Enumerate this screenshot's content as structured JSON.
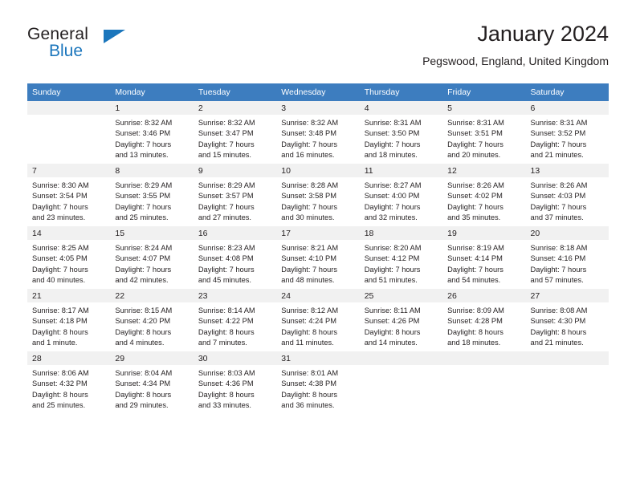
{
  "brand": {
    "line1": "General",
    "line2": "Blue",
    "triangle_color": "#1b76bc"
  },
  "header": {
    "title": "January 2024",
    "subtitle": "Pegswood, England, United Kingdom"
  },
  "theme": {
    "header_row_bg": "#3d7dbf",
    "header_row_text": "#ffffff",
    "daynum_bg": "#f1f1f1",
    "body_text": "#231f20"
  },
  "weekday_headers": [
    "Sunday",
    "Monday",
    "Tuesday",
    "Wednesday",
    "Thursday",
    "Friday",
    "Saturday"
  ],
  "weeks": [
    [
      {
        "day": "",
        "lines": []
      },
      {
        "day": "1",
        "lines": [
          "Sunrise: 8:32 AM",
          "Sunset: 3:46 PM",
          "Daylight: 7 hours",
          "and 13 minutes."
        ]
      },
      {
        "day": "2",
        "lines": [
          "Sunrise: 8:32 AM",
          "Sunset: 3:47 PM",
          "Daylight: 7 hours",
          "and 15 minutes."
        ]
      },
      {
        "day": "3",
        "lines": [
          "Sunrise: 8:32 AM",
          "Sunset: 3:48 PM",
          "Daylight: 7 hours",
          "and 16 minutes."
        ]
      },
      {
        "day": "4",
        "lines": [
          "Sunrise: 8:31 AM",
          "Sunset: 3:50 PM",
          "Daylight: 7 hours",
          "and 18 minutes."
        ]
      },
      {
        "day": "5",
        "lines": [
          "Sunrise: 8:31 AM",
          "Sunset: 3:51 PM",
          "Daylight: 7 hours",
          "and 20 minutes."
        ]
      },
      {
        "day": "6",
        "lines": [
          "Sunrise: 8:31 AM",
          "Sunset: 3:52 PM",
          "Daylight: 7 hours",
          "and 21 minutes."
        ]
      }
    ],
    [
      {
        "day": "7",
        "lines": [
          "Sunrise: 8:30 AM",
          "Sunset: 3:54 PM",
          "Daylight: 7 hours",
          "and 23 minutes."
        ]
      },
      {
        "day": "8",
        "lines": [
          "Sunrise: 8:29 AM",
          "Sunset: 3:55 PM",
          "Daylight: 7 hours",
          "and 25 minutes."
        ]
      },
      {
        "day": "9",
        "lines": [
          "Sunrise: 8:29 AM",
          "Sunset: 3:57 PM",
          "Daylight: 7 hours",
          "and 27 minutes."
        ]
      },
      {
        "day": "10",
        "lines": [
          "Sunrise: 8:28 AM",
          "Sunset: 3:58 PM",
          "Daylight: 7 hours",
          "and 30 minutes."
        ]
      },
      {
        "day": "11",
        "lines": [
          "Sunrise: 8:27 AM",
          "Sunset: 4:00 PM",
          "Daylight: 7 hours",
          "and 32 minutes."
        ]
      },
      {
        "day": "12",
        "lines": [
          "Sunrise: 8:26 AM",
          "Sunset: 4:02 PM",
          "Daylight: 7 hours",
          "and 35 minutes."
        ]
      },
      {
        "day": "13",
        "lines": [
          "Sunrise: 8:26 AM",
          "Sunset: 4:03 PM",
          "Daylight: 7 hours",
          "and 37 minutes."
        ]
      }
    ],
    [
      {
        "day": "14",
        "lines": [
          "Sunrise: 8:25 AM",
          "Sunset: 4:05 PM",
          "Daylight: 7 hours",
          "and 40 minutes."
        ]
      },
      {
        "day": "15",
        "lines": [
          "Sunrise: 8:24 AM",
          "Sunset: 4:07 PM",
          "Daylight: 7 hours",
          "and 42 minutes."
        ]
      },
      {
        "day": "16",
        "lines": [
          "Sunrise: 8:23 AM",
          "Sunset: 4:08 PM",
          "Daylight: 7 hours",
          "and 45 minutes."
        ]
      },
      {
        "day": "17",
        "lines": [
          "Sunrise: 8:21 AM",
          "Sunset: 4:10 PM",
          "Daylight: 7 hours",
          "and 48 minutes."
        ]
      },
      {
        "day": "18",
        "lines": [
          "Sunrise: 8:20 AM",
          "Sunset: 4:12 PM",
          "Daylight: 7 hours",
          "and 51 minutes."
        ]
      },
      {
        "day": "19",
        "lines": [
          "Sunrise: 8:19 AM",
          "Sunset: 4:14 PM",
          "Daylight: 7 hours",
          "and 54 minutes."
        ]
      },
      {
        "day": "20",
        "lines": [
          "Sunrise: 8:18 AM",
          "Sunset: 4:16 PM",
          "Daylight: 7 hours",
          "and 57 minutes."
        ]
      }
    ],
    [
      {
        "day": "21",
        "lines": [
          "Sunrise: 8:17 AM",
          "Sunset: 4:18 PM",
          "Daylight: 8 hours",
          "and 1 minute."
        ]
      },
      {
        "day": "22",
        "lines": [
          "Sunrise: 8:15 AM",
          "Sunset: 4:20 PM",
          "Daylight: 8 hours",
          "and 4 minutes."
        ]
      },
      {
        "day": "23",
        "lines": [
          "Sunrise: 8:14 AM",
          "Sunset: 4:22 PM",
          "Daylight: 8 hours",
          "and 7 minutes."
        ]
      },
      {
        "day": "24",
        "lines": [
          "Sunrise: 8:12 AM",
          "Sunset: 4:24 PM",
          "Daylight: 8 hours",
          "and 11 minutes."
        ]
      },
      {
        "day": "25",
        "lines": [
          "Sunrise: 8:11 AM",
          "Sunset: 4:26 PM",
          "Daylight: 8 hours",
          "and 14 minutes."
        ]
      },
      {
        "day": "26",
        "lines": [
          "Sunrise: 8:09 AM",
          "Sunset: 4:28 PM",
          "Daylight: 8 hours",
          "and 18 minutes."
        ]
      },
      {
        "day": "27",
        "lines": [
          "Sunrise: 8:08 AM",
          "Sunset: 4:30 PM",
          "Daylight: 8 hours",
          "and 21 minutes."
        ]
      }
    ],
    [
      {
        "day": "28",
        "lines": [
          "Sunrise: 8:06 AM",
          "Sunset: 4:32 PM",
          "Daylight: 8 hours",
          "and 25 minutes."
        ]
      },
      {
        "day": "29",
        "lines": [
          "Sunrise: 8:04 AM",
          "Sunset: 4:34 PM",
          "Daylight: 8 hours",
          "and 29 minutes."
        ]
      },
      {
        "day": "30",
        "lines": [
          "Sunrise: 8:03 AM",
          "Sunset: 4:36 PM",
          "Daylight: 8 hours",
          "and 33 minutes."
        ]
      },
      {
        "day": "31",
        "lines": [
          "Sunrise: 8:01 AM",
          "Sunset: 4:38 PM",
          "Daylight: 8 hours",
          "and 36 minutes."
        ]
      },
      {
        "day": "",
        "lines": []
      },
      {
        "day": "",
        "lines": []
      },
      {
        "day": "",
        "lines": []
      }
    ]
  ]
}
